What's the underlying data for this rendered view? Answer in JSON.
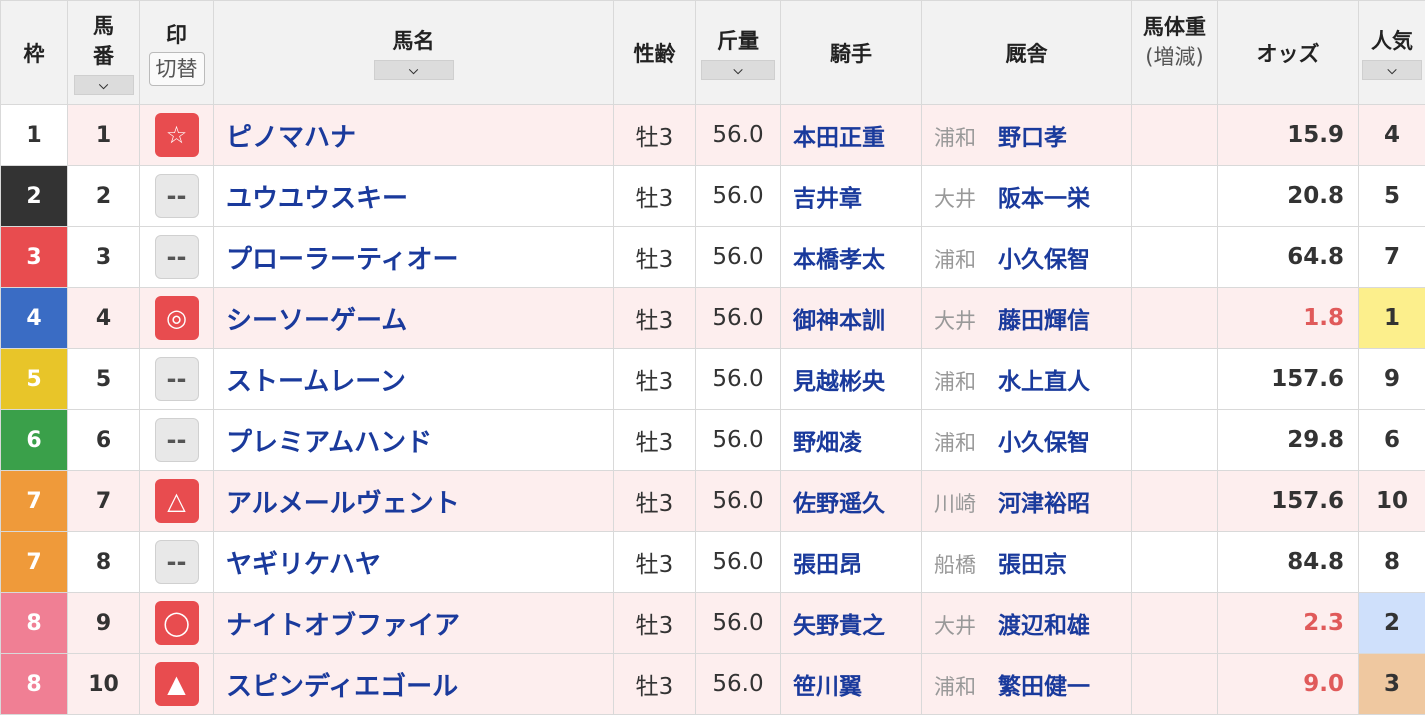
{
  "headers": {
    "waku": "枠",
    "umaban_1": "馬",
    "umaban_2": "番",
    "mark": "印",
    "mark_switch": "切替",
    "horse": "馬名",
    "sex_age": "性齢",
    "weight": "斤量",
    "jockey": "騎手",
    "stable": "厩舎",
    "body_weight": "馬体重",
    "body_weight_diff": "(増減)",
    "odds": "オッズ",
    "pop": "人気",
    "sort_glyph": "⌵"
  },
  "colors": {
    "waku1": "#ffffff",
    "waku2": "#333333",
    "waku3": "#e84c4f",
    "waku4": "#3a6cc4",
    "waku5": "#e8c529",
    "waku6": "#3aa04a",
    "waku7": "#ef9a3a",
    "waku8": "#f07f94",
    "pop1": "#fcef8c",
    "pop2": "#cfe0fb",
    "pop3": "#efc8a0"
  },
  "rows": [
    {
      "waku": "1",
      "umaban": "1",
      "mark": "☆",
      "mark_on": true,
      "horse": "ピノマハナ",
      "sex_age": "牡3",
      "weight": "56.0",
      "jockey": "本田正重",
      "region": "浦和",
      "trainer": "野口孝",
      "body_weight": "",
      "odds": "15.9",
      "pop": "4"
    },
    {
      "waku": "2",
      "umaban": "2",
      "mark": "--",
      "mark_on": false,
      "horse": "ユウユウスキー",
      "sex_age": "牡3",
      "weight": "56.0",
      "jockey": "吉井章",
      "region": "大井",
      "trainer": "阪本一栄",
      "body_weight": "",
      "odds": "20.8",
      "pop": "5"
    },
    {
      "waku": "3",
      "umaban": "3",
      "mark": "--",
      "mark_on": false,
      "horse": "プローラーティオー",
      "sex_age": "牡3",
      "weight": "56.0",
      "jockey": "本橋孝太",
      "region": "浦和",
      "trainer": "小久保智",
      "body_weight": "",
      "odds": "64.8",
      "pop": "7"
    },
    {
      "waku": "4",
      "umaban": "4",
      "mark": "◎",
      "mark_on": true,
      "horse": "シーソーゲーム",
      "sex_age": "牡3",
      "weight": "56.0",
      "jockey": "御神本訓",
      "region": "大井",
      "trainer": "藤田輝信",
      "body_weight": "",
      "odds": "1.8",
      "pop": "1"
    },
    {
      "waku": "5",
      "umaban": "5",
      "mark": "--",
      "mark_on": false,
      "horse": "ストームレーン",
      "sex_age": "牡3",
      "weight": "56.0",
      "jockey": "見越彬央",
      "region": "浦和",
      "trainer": "水上直人",
      "body_weight": "",
      "odds": "157.6",
      "pop": "9"
    },
    {
      "waku": "6",
      "umaban": "6",
      "mark": "--",
      "mark_on": false,
      "horse": "プレミアムハンド",
      "sex_age": "牡3",
      "weight": "56.0",
      "jockey": "野畑凌",
      "region": "浦和",
      "trainer": "小久保智",
      "body_weight": "",
      "odds": "29.8",
      "pop": "6"
    },
    {
      "waku": "7",
      "umaban": "7",
      "mark": "△",
      "mark_on": true,
      "horse": "アルメールヴェント",
      "sex_age": "牡3",
      "weight": "56.0",
      "jockey": "佐野遥久",
      "region": "川崎",
      "trainer": "河津裕昭",
      "body_weight": "",
      "odds": "157.6",
      "pop": "10"
    },
    {
      "waku": "7",
      "umaban": "8",
      "mark": "--",
      "mark_on": false,
      "horse": "ヤギリケハヤ",
      "sex_age": "牡3",
      "weight": "56.0",
      "jockey": "張田昂",
      "region": "船橋",
      "trainer": "張田京",
      "body_weight": "",
      "odds": "84.8",
      "pop": "8"
    },
    {
      "waku": "8",
      "umaban": "9",
      "mark": "◯",
      "mark_on": true,
      "horse": "ナイトオブファイア",
      "sex_age": "牡3",
      "weight": "56.0",
      "jockey": "矢野貴之",
      "region": "大井",
      "trainer": "渡辺和雄",
      "body_weight": "",
      "odds": "2.3",
      "pop": "2"
    },
    {
      "waku": "8",
      "umaban": "10",
      "mark": "▲",
      "mark_on": true,
      "horse": "スピンディエゴール",
      "sex_age": "牡3",
      "weight": "56.0",
      "jockey": "笹川翼",
      "region": "浦和",
      "trainer": "繁田健一",
      "body_weight": "",
      "odds": "9.0",
      "pop": "3"
    }
  ]
}
